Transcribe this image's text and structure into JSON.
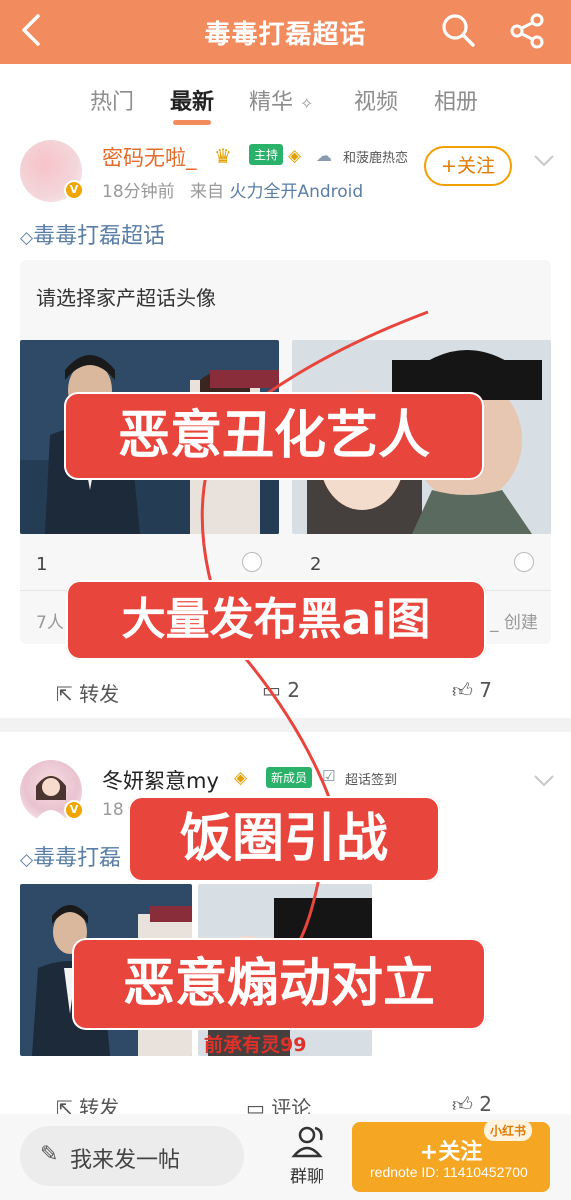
{
  "header": {
    "title": "毒毒打磊超话",
    "back_icon": "chevron-left-icon",
    "search_icon": "search-icon",
    "share_icon": "share-icon"
  },
  "tabs": [
    "热门",
    "最新",
    "精华",
    "视频",
    "相册"
  ],
  "active_tab_index": 1,
  "colors": {
    "header_bg": "#f28b5e",
    "accent": "#f28b5e",
    "author_orange": "#e26b2b",
    "topic_blue": "#5a7ea6",
    "overlay_red": "#e8453c",
    "follow_orange": "#f5a623",
    "badge_green": "#2ab26a"
  },
  "post1": {
    "author": "密码无啦_",
    "host_tag": "主持",
    "fan_tag": "和菠鹿热恋",
    "time": "18分钟前",
    "source_prefix": "来自",
    "source": "火力全开Android",
    "follow": "+关注",
    "topic": "毒毒打磊超话",
    "vote_title": "请选择家产超话头像",
    "options": [
      "1",
      "2"
    ],
    "vote_count": "7人",
    "vote_suffix": "_ 创建",
    "actions": {
      "repost": "转发",
      "comment_count": "2",
      "like_count": "7"
    }
  },
  "post2": {
    "author": "冬妍絮意my",
    "new_tag": "新成员",
    "checkin_tag": "超话签到",
    "time": "18",
    "topic": "毒毒打磊",
    "photo_caption": "前承有灵99",
    "actions": {
      "repost": "转发",
      "comment": "评论",
      "like_count": "2"
    }
  },
  "overlays": {
    "o1": "恶意丑化艺人",
    "o2": "大量发布黑ai图",
    "o3": "饭圈引战",
    "o4": "恶意煽动对立"
  },
  "bottom": {
    "compose": "我来发一帖",
    "group": "群聊",
    "follow": "+关注",
    "xhs_badge": "小红书",
    "rednote_id": "rednote ID: 11410452700"
  }
}
